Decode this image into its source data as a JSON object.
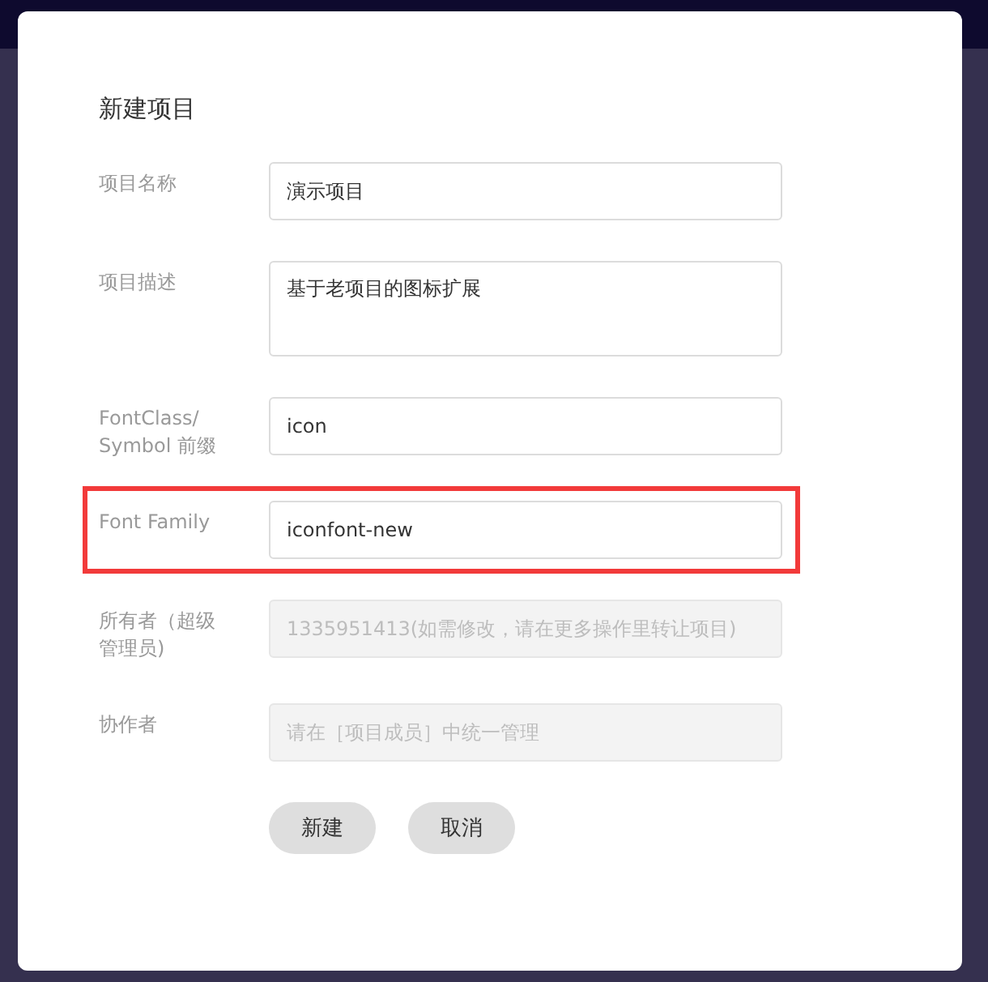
{
  "dialog": {
    "title": "新建项目",
    "fields": [
      {
        "label": "项目名称",
        "kind": "input",
        "value": "演示项目",
        "disabled": false,
        "highlighted": false
      },
      {
        "label": "项目描述",
        "kind": "textarea",
        "value": "基于老项目的图标扩展",
        "disabled": false,
        "highlighted": false
      },
      {
        "label": "FontClass/ Symbol 前缀",
        "kind": "input",
        "value": "icon",
        "disabled": false,
        "highlighted": false
      },
      {
        "label": "Font Family",
        "kind": "input",
        "value": "iconfont-new",
        "disabled": false,
        "highlighted": true
      },
      {
        "label": "所有者（超级管理员)",
        "kind": "input",
        "placeholder": "1335951413(如需修改，请在更多操作里转让项目)",
        "disabled": true,
        "highlighted": false
      },
      {
        "label": "协作者",
        "kind": "input",
        "placeholder": "请在［项目成员］中统一管理",
        "disabled": true,
        "highlighted": false
      }
    ],
    "buttons": [
      "新建",
      "取消"
    ]
  }
}
